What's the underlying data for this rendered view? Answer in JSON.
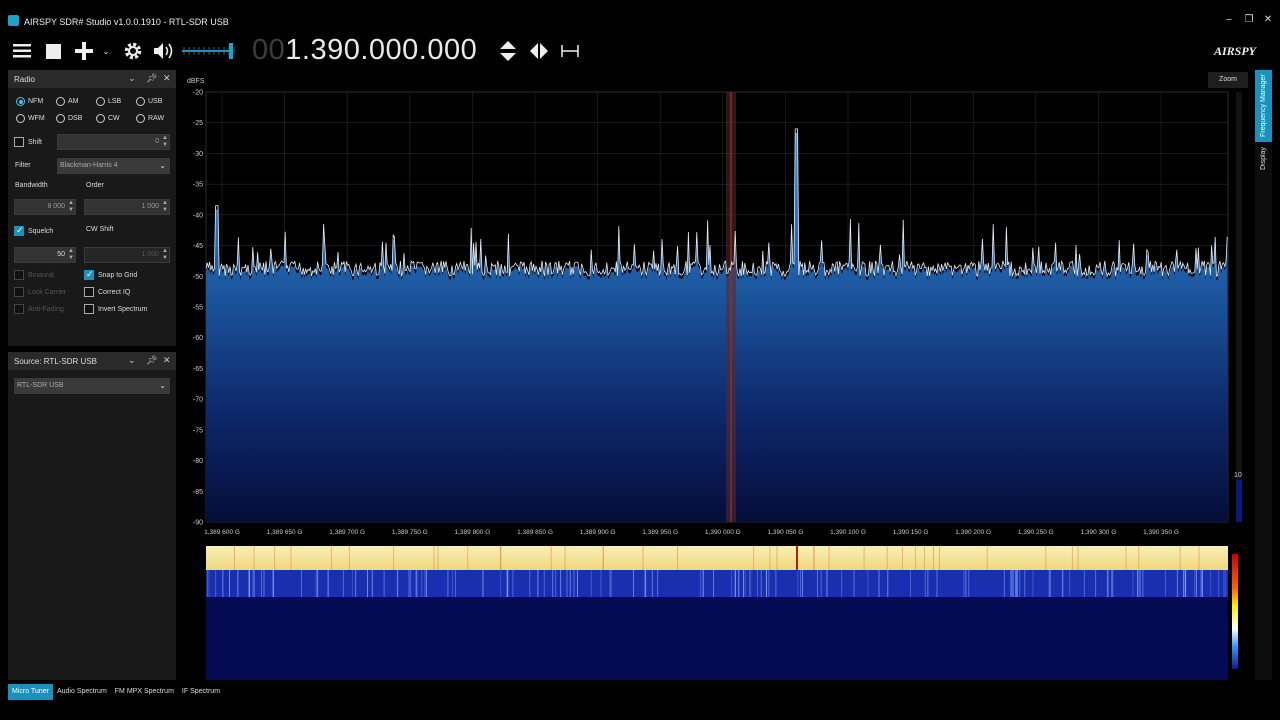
{
  "window": {
    "title": "AIRSPY SDR# Studio v1.0.0.1910 - RTL-SDR USB"
  },
  "frequency": {
    "leading": "00",
    "main": "1.390.000.000"
  },
  "logo": "AIRSPY",
  "radio_panel": {
    "title": "Radio",
    "modes": [
      {
        "label": "NFM",
        "selected": true
      },
      {
        "label": "AM",
        "selected": false
      },
      {
        "label": "LSB",
        "selected": false
      },
      {
        "label": "USB",
        "selected": false
      },
      {
        "label": "WFM",
        "selected": false
      },
      {
        "label": "DSB",
        "selected": false
      },
      {
        "label": "CW",
        "selected": false
      },
      {
        "label": "RAW",
        "selected": false
      }
    ],
    "shift_label": "Shift",
    "shift_value": "0",
    "filter_label": "Filter",
    "filter_value": "Blackman-Harris 4",
    "bandwidth_label": "Bandwidth",
    "bandwidth_value": "8 000",
    "order_label": "Order",
    "order_value": "1 000",
    "squelch_label": "Squelch",
    "squelch_value": "50",
    "cw_shift_label": "CW Shift",
    "cw_shift_value": "1 000",
    "binaural_label": "Binaural",
    "lock_carrier_label": "Lock Carrier",
    "anti_fading_label": "Anti-Fading",
    "snap_label": "Snap to Grid",
    "correct_iq_label": "Correct IQ",
    "invert_label": "Invert Spectrum"
  },
  "source_panel": {
    "title": "Source: RTL-SDR USB",
    "device": "RTL-SDR USB"
  },
  "spectrum": {
    "unit_label": "dBFS",
    "y_ticks": [
      "-20",
      "-25",
      "-30",
      "-35",
      "-40",
      "-45",
      "-50",
      "-55",
      "-60",
      "-65",
      "-70",
      "-75",
      "-80",
      "-85",
      "-90"
    ],
    "x_ticks": [
      "1,389 600 G",
      "1,389 650 G",
      "1,389 700 G",
      "1,389 750 G",
      "1,389 800 G",
      "1,389 850 G",
      "1,389 900 G",
      "1,389 950 G",
      "1,390 000 G",
      "1,390 050 G",
      "1,390 100 G",
      "1,390 150 G",
      "1,390 200 G",
      "1,390 250 G",
      "1,390 300 G",
      "1,390 350 G"
    ],
    "zoom_label": "Zoom",
    "level_label": "10"
  },
  "side_tabs": {
    "frequency_manager": "Frequency Manager",
    "display": "Display"
  },
  "bottom_tabs": [
    "Micro Tuner",
    "Audio Spectrum",
    "FM MPX Spectrum",
    "IF Spectrum"
  ],
  "colors": {
    "accent": "#1993bd",
    "spectrum_fill": "#2d7cc0",
    "waterfall_hot": "#f3e9a0",
    "waterfall_cold": "#0a1a6a"
  }
}
